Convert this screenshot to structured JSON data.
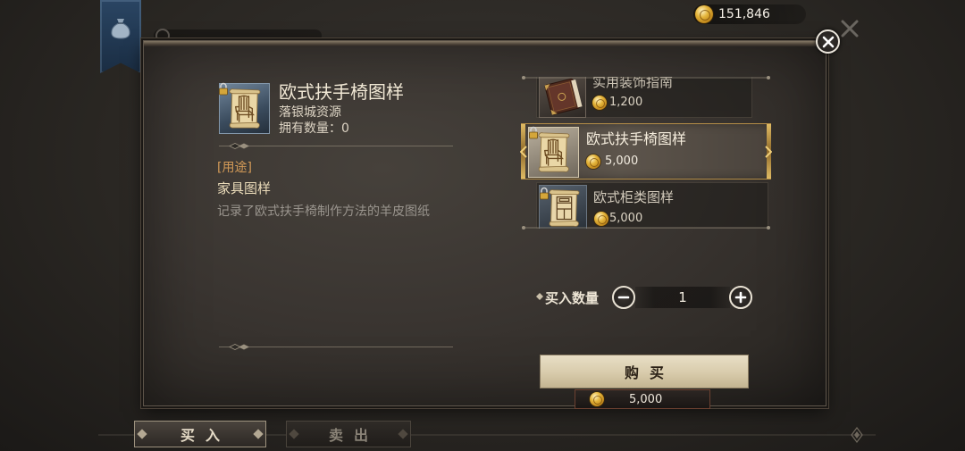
{
  "currency": {
    "amount": "151,846",
    "icon": "gold-coin"
  },
  "detail": {
    "icon": "chair-blueprint",
    "locked": true,
    "title": "欧式扶手椅图样",
    "source": "落银城资源",
    "owned": "拥有数量：0",
    "usage_heading": "[用途]",
    "category": "家具图样",
    "description": "记录了欧式扶手椅制作方法的羊皮图纸"
  },
  "shop_items": [
    {
      "name": "实用装饰指南",
      "price": "1,200",
      "icon": "book",
      "locked": false,
      "selected": false
    },
    {
      "name": "欧式扶手椅图样",
      "price": "5,000",
      "icon": "chair-blueprint",
      "locked": true,
      "selected": true
    },
    {
      "name": "欧式柜类图样",
      "price": "5,000",
      "icon": "cabinet-blueprint",
      "locked": true,
      "selected": false
    }
  ],
  "purchase": {
    "quantity_label": "买入数量",
    "quantity": "1",
    "buy_label": "购买",
    "total_price": "5,000",
    "price_icon": "gold-coin"
  },
  "tabs": [
    {
      "label": "买入",
      "selected": true
    },
    {
      "label": "卖出",
      "selected": false
    }
  ],
  "colors": {
    "gold": "#e4b43a",
    "usage_heading": "#d39a57",
    "title_text": "#f1e8d5",
    "buy_button": "#d8cbab"
  }
}
